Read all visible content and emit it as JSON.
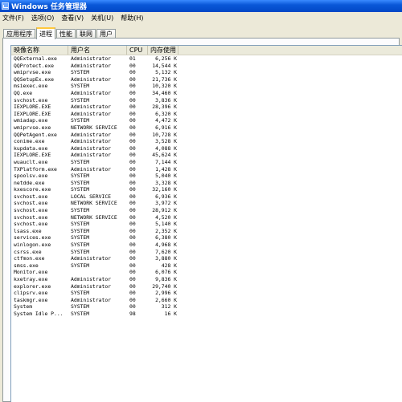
{
  "window": {
    "title": "Windows 任务管理器"
  },
  "menu": [
    "文件(F)",
    "选项(O)",
    "查看(V)",
    "关机(U)",
    "帮助(H)"
  ],
  "tabs": [
    {
      "label": "应用程序",
      "active": false
    },
    {
      "label": "进程",
      "active": true
    },
    {
      "label": "性能",
      "active": false
    },
    {
      "label": "联网",
      "active": false
    },
    {
      "label": "用户",
      "active": false
    }
  ],
  "columns": [
    "映像名称",
    "用户名",
    "CPU",
    "内存使用"
  ],
  "processes": [
    [
      "QQExternal.exe",
      "Administrator",
      "01",
      "6,256 K"
    ],
    [
      "QQProtect.exe",
      "Administrator",
      "00",
      "14,544 K"
    ],
    [
      "wmiprvse.exe",
      "SYSTEM",
      "00",
      "5,132 K"
    ],
    [
      "QQSetupEx.exe",
      "Administrator",
      "00",
      "21,736 K"
    ],
    [
      "msiexec.exe",
      "SYSTEM",
      "00",
      "10,320 K"
    ],
    [
      "QQ.exe",
      "Administrator",
      "00",
      "34,460 K"
    ],
    [
      "svchost.exe",
      "SYSTEM",
      "00",
      "3,836 K"
    ],
    [
      "IEXPLORE.EXE",
      "Administrator",
      "00",
      "28,396 K"
    ],
    [
      "IEXPLORE.EXE",
      "Administrator",
      "00",
      "6,320 K"
    ],
    [
      "wmiadap.exe",
      "SYSTEM",
      "00",
      "4,472 K"
    ],
    [
      "wmiprvse.exe",
      "NETWORK SERVICE",
      "00",
      "6,916 K"
    ],
    [
      "QQPetAgent.exe",
      "Administrator",
      "00",
      "10,728 K"
    ],
    [
      "conime.exe",
      "Administrator",
      "00",
      "3,528 K"
    ],
    [
      "kupdata.exe",
      "Administrator",
      "00",
      "4,088 K"
    ],
    [
      "IEXPLORE.EXE",
      "Administrator",
      "00",
      "45,624 K"
    ],
    [
      "wuauclt.exe",
      "SYSTEM",
      "00",
      "7,144 K"
    ],
    [
      "TXPlatform.exe",
      "Administrator",
      "00",
      "1,428 K"
    ],
    [
      "spoolsv.exe",
      "SYSTEM",
      "00",
      "5,040 K"
    ],
    [
      "netdde.exe",
      "SYSTEM",
      "00",
      "3,328 K"
    ],
    [
      "kxescore.exe",
      "SYSTEM",
      "00",
      "32,160 K"
    ],
    [
      "svchost.exe",
      "LOCAL SERVICE",
      "00",
      "6,936 K"
    ],
    [
      "svchost.exe",
      "NETWORK SERVICE",
      "00",
      "3,972 K"
    ],
    [
      "svchost.exe",
      "SYSTEM",
      "00",
      "28,912 K"
    ],
    [
      "svchost.exe",
      "NETWORK SERVICE",
      "00",
      "4,520 K"
    ],
    [
      "svchost.exe",
      "SYSTEM",
      "00",
      "5,140 K"
    ],
    [
      "lsass.exe",
      "SYSTEM",
      "00",
      "2,352 K"
    ],
    [
      "services.exe",
      "SYSTEM",
      "00",
      "6,380 K"
    ],
    [
      "winlogon.exe",
      "SYSTEM",
      "00",
      "4,968 K"
    ],
    [
      "csrss.exe",
      "SYSTEM",
      "00",
      "7,620 K"
    ],
    [
      "ctfmon.exe",
      "Administrator",
      "00",
      "3,880 K"
    ],
    [
      "smss.exe",
      "SYSTEM",
      "00",
      "428 K"
    ],
    [
      "Monitor.exe",
      "",
      "00",
      "6,076 K"
    ],
    [
      "kxetray.exe",
      "Administrator",
      "00",
      "9,836 K"
    ],
    [
      "explorer.exe",
      "Administrator",
      "00",
      "29,740 K"
    ],
    [
      "clipsrv.exe",
      "SYSTEM",
      "00",
      "2,996 K"
    ],
    [
      "taskmgr.exe",
      "Administrator",
      "00",
      "2,660 K"
    ],
    [
      "System",
      "SYSTEM",
      "00",
      "312 K"
    ],
    [
      "System Idle P...",
      "SYSTEM",
      "98",
      "16 K"
    ]
  ]
}
